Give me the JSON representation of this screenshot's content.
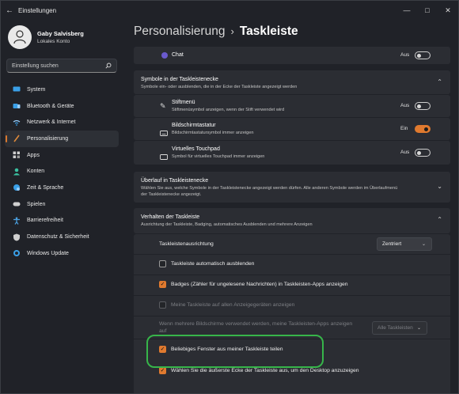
{
  "window": {
    "title": "Einstellungen"
  },
  "user": {
    "name": "Gaby Salvisberg",
    "account": "Lokales Konto"
  },
  "search": {
    "placeholder": "Einstellung suchen"
  },
  "nav": [
    {
      "label": "System",
      "icon": "monitor-icon",
      "color": "#3aa0e8"
    },
    {
      "label": "Bluetooth & Geräte",
      "icon": "bluetooth-icon",
      "color": "#3aa0e8"
    },
    {
      "label": "Netzwerk & Internet",
      "icon": "wifi-icon",
      "color": "#9ad0ff"
    },
    {
      "label": "Personalisierung",
      "icon": "brush-icon",
      "color": "#e08a3a"
    },
    {
      "label": "Apps",
      "icon": "apps-icon",
      "color": "#cfcfcf"
    },
    {
      "label": "Konten",
      "icon": "person-icon",
      "color": "#3ac0a0"
    },
    {
      "label": "Zeit & Sprache",
      "icon": "globe-clock-icon",
      "color": "#3aa0e8"
    },
    {
      "label": "Spielen",
      "icon": "gamepad-icon",
      "color": "#cfcfcf"
    },
    {
      "label": "Barrierefreiheit",
      "icon": "accessibility-icon",
      "color": "#4aa0e0"
    },
    {
      "label": "Datenschutz & Sicherheit",
      "icon": "shield-icon",
      "color": "#cfcfcf"
    },
    {
      "label": "Windows Update",
      "icon": "update-icon",
      "color": "#3aa0e8"
    }
  ],
  "breadcrumb": {
    "parent": "Personalisierung",
    "current": "Taskleiste"
  },
  "chat": {
    "label": "Chat",
    "state": "Aus"
  },
  "corner_icons": {
    "title": "Symbole in der Taskleistenecke",
    "subtitle": "Symbole ein- oder ausblenden, die in der Ecke der Taskleiste angezeigt werden",
    "items": [
      {
        "title": "Stiftmenü",
        "subtitle": "Stiftmenüsymbol anzeigen, wenn der Stift verwendet wird",
        "state": "Aus"
      },
      {
        "title": "Bildschirmtastatur",
        "subtitle": "Bildschirmtastatursymbol immer anzeigen",
        "state": "Ein"
      },
      {
        "title": "Virtuelles Touchpad",
        "subtitle": "Symbol für virtuelles Touchpad immer anzeigen",
        "state": "Aus"
      }
    ]
  },
  "overflow": {
    "title": "Überlauf in Taskleistenecke",
    "subtitle1": "Wählen Sie aus, welche Symbole in der Taskleistenecke angezeigt werden dürfen. Alle anderen Symbole werden im Überlaufmenü",
    "subtitle2": "der Taskleistenecke angezeigt."
  },
  "behavior": {
    "title": "Verhalten der Taskleiste",
    "subtitle": "Ausrichtung der Taskleiste, Badging, automatisches Ausblenden und mehrere Anzeigen",
    "alignment_label": "Taskleistenausrichtung",
    "alignment_value": "Zentriert",
    "options": [
      {
        "label": "Taskleiste automatisch ausblenden"
      },
      {
        "label": "Badges (Zähler für ungelesene Nachrichten) in Taskleisten-Apps anzeigen"
      },
      {
        "label": "Meine Taskleiste auf allen Anzeigegeräten anzeigen"
      }
    ],
    "multi_label1": "Wenn mehrere Bildschirme verwendet werden, meine Taskleisten-Apps anzeigen",
    "multi_label2": "auf",
    "multi_value": "Alle Taskleisten",
    "share_label": "Beliebiges Fenster aus meiner Taskleiste teilen",
    "corner_label": "Wählen Sie die äußerste Ecke der Taskleiste aus, um den Desktop anzuzeigen"
  },
  "colors": {
    "accent": "#e07a2f",
    "highlight": "#37b54a"
  }
}
